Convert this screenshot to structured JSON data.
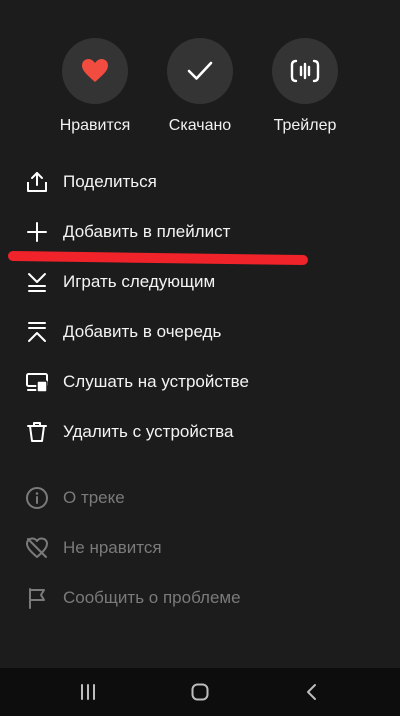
{
  "actions": {
    "like_label": "Нравится",
    "downloaded_label": "Скачано",
    "trailer_label": "Трейлер"
  },
  "menu": {
    "share": "Поделиться",
    "add_to_playlist": "Добавить в плейлист",
    "play_next": "Играть следующим",
    "add_to_queue": "Добавить в очередь",
    "listen_on_device": "Слушать на устройстве",
    "delete_from_device": "Удалить с устройства",
    "about_track": "О треке",
    "dislike": "Не нравится",
    "report_problem": "Сообщить о проблеме"
  },
  "colors": {
    "like": "#f24b3f",
    "annotation": "#f0222a",
    "dim_text": "#7a7a7a"
  },
  "icons": {
    "like": "heart-icon",
    "downloaded": "checkmark-icon",
    "trailer": "waveform-icon",
    "share": "share-icon",
    "add": "plus-icon",
    "play_next": "play-next-icon",
    "queue": "queue-icon",
    "device": "device-icon",
    "delete": "trash-icon",
    "info": "info-icon",
    "dislike": "broken-heart-icon",
    "report": "flag-icon"
  }
}
